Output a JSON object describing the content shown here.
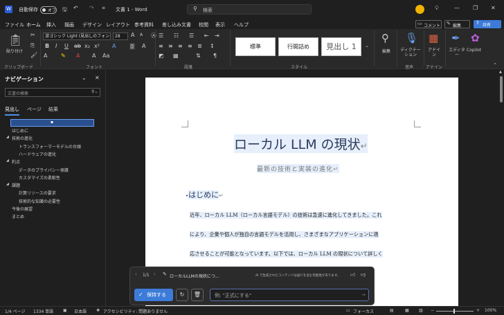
{
  "titlebar": {
    "autosave_label": "自動保存",
    "autosave_state": "オフ",
    "doc_title": "文書 1 - Word",
    "search_placeholder": "検索"
  },
  "menu": [
    "ファイル",
    "ホーム",
    "挿入",
    "描画",
    "デザイン",
    "レイアウト",
    "参考資料",
    "差し込み文書",
    "校閲",
    "表示",
    "ヘルプ"
  ],
  "menu_active": 1,
  "right_buttons": {
    "comment": "コメント",
    "edit": "編集",
    "share": "共有"
  },
  "ribbon": {
    "paste": "貼り付け",
    "clipboard": "クリップボード",
    "font_name": "游ゴシック Light (見出しのフォント",
    "font_size": "28",
    "font_group": "フォント",
    "paragraph_group": "段落",
    "styles": [
      "標準",
      "行間詰め",
      "見出し 1"
    ],
    "styles_group": "スタイル",
    "edit": "編集",
    "dictation": "ディクテーション",
    "voice_group": "音声",
    "addin": "アドイン",
    "addin_group": "アドイン",
    "editor": "エディター",
    "copilot": "Copilot"
  },
  "nav": {
    "title": "ナビゲーション",
    "search_placeholder": "文書の検索",
    "tabs": [
      "見出し",
      "ページ",
      "結果"
    ],
    "items": [
      {
        "label": "はじめに",
        "level": 1,
        "expand": ""
      },
      {
        "label": "技術の進化",
        "level": 1,
        "expand": "◢"
      },
      {
        "label": "トランスフォーマーモデルの台頭",
        "level": 2,
        "expand": ""
      },
      {
        "label": "ハードウェアの進化",
        "level": 2,
        "expand": ""
      },
      {
        "label": "利点",
        "level": 1,
        "expand": "◢"
      },
      {
        "label": "データのプライバシー保護",
        "level": 2,
        "expand": ""
      },
      {
        "label": "カスタマイズの柔軟性",
        "level": 2,
        "expand": ""
      },
      {
        "label": "課題",
        "level": 1,
        "expand": "◢"
      },
      {
        "label": "計算リソースの要求",
        "level": 2,
        "expand": ""
      },
      {
        "label": "技術的な知識の必要性",
        "level": 2,
        "expand": ""
      },
      {
        "label": "今後の展望",
        "level": 1,
        "expand": ""
      },
      {
        "label": "まとめ",
        "level": 1,
        "expand": ""
      }
    ]
  },
  "doc": {
    "title": "ローカル LLM の現状",
    "subtitle": "最新の技術と実装の進化",
    "heading1": "はじめに",
    "para": [
      "近年、ローカル LLM（ローカル言語モデル）の技術は急速に進化してきました。これ",
      "により、企業や個人が独自の言語モデルを活用し、さまざまなアプリケーションに適",
      "応させることが可能となっています。以下では、ローカル LLM の現状について詳しく"
    ],
    "para_mark": "↵"
  },
  "copilot": {
    "page": "1/1",
    "doc_label": "ローカルLLMの現状につ...",
    "disclaimer": "AI で生成されたコンテンツは誤りを含む可能性があります。",
    "keep": "保持する",
    "prompt_placeholder": "例: \"正式にする\""
  },
  "status": {
    "page": "1/4 ページ",
    "words": "1334 単語",
    "language": "日本語",
    "accessibility": "アクセシビリティ: 問題ありません",
    "focus": "フォーカス",
    "zoom": "100%"
  },
  "colors": {
    "accent": "#4d8fe6",
    "keep_button": "#3d7bd9",
    "page_bg": "#ffffff",
    "app_bg": "#1f1f1f"
  }
}
